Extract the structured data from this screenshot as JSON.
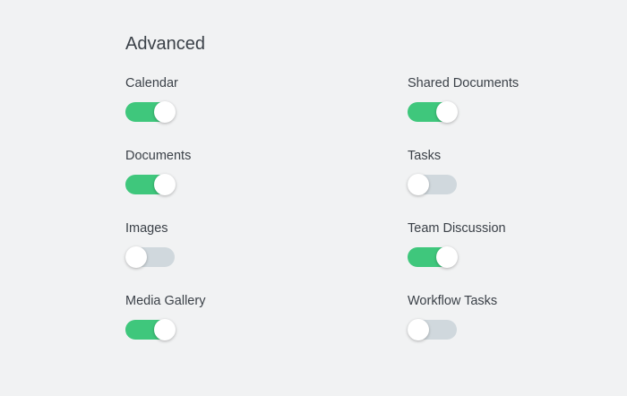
{
  "section": {
    "title": "Advanced"
  },
  "settings": {
    "left": [
      {
        "label": "Calendar",
        "enabled": true
      },
      {
        "label": "Documents",
        "enabled": true
      },
      {
        "label": "Images",
        "enabled": false
      },
      {
        "label": "Media Gallery",
        "enabled": true
      }
    ],
    "right": [
      {
        "label": "Shared Documents",
        "enabled": true
      },
      {
        "label": "Tasks",
        "enabled": false
      },
      {
        "label": "Team Discussion",
        "enabled": true
      },
      {
        "label": "Workflow Tasks",
        "enabled": false
      }
    ]
  },
  "colors": {
    "toggle_on": "#3fc77c",
    "toggle_off": "#d0d8dd",
    "background": "#f1f2f3"
  }
}
